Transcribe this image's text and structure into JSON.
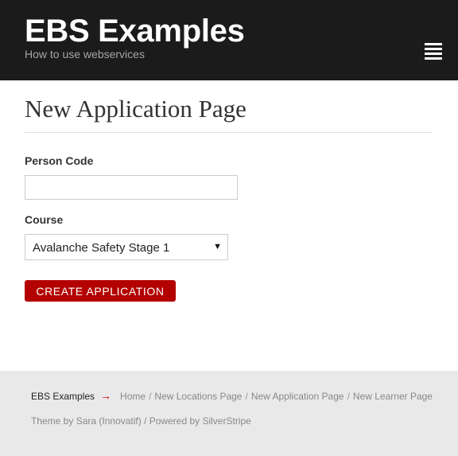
{
  "header": {
    "title": "EBS Examples",
    "tagline": "How to use webservices",
    "menu_icon": "hamburger-menu-icon"
  },
  "main": {
    "page_title": "New Application Page",
    "form": {
      "person_code_label": "Person Code",
      "person_code_value": "",
      "person_code_placeholder": "",
      "course_label": "Course",
      "course_selected": "Avalanche Safety Stage 1",
      "submit_label": "CREATE APPLICATION"
    }
  },
  "footer": {
    "brand": "EBS Examples",
    "arrow": "→",
    "nav": [
      "Home",
      "New Locations Page",
      "New Application Page",
      "New Learner Page"
    ],
    "separator": "/",
    "credits": {
      "theme_prefix": "Theme by ",
      "theme_author": "Sara (Innovatif)",
      "powered_prefix": " / Powered by ",
      "powered_by": "SilverStripe"
    }
  },
  "colors": {
    "header_bg": "#1b1b1b",
    "button": "#b30000",
    "footer_bg": "#e9e9e9",
    "accent_arrow": "#cc0000"
  }
}
